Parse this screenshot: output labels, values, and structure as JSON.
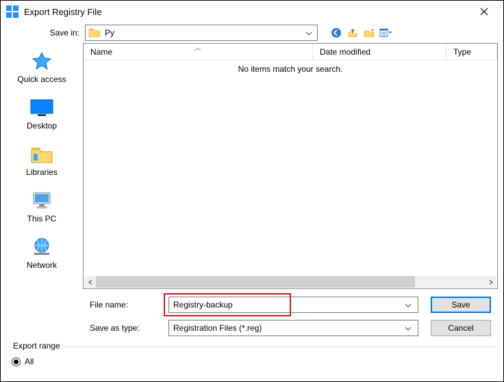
{
  "title": "Export Registry File",
  "save_in_label": "Save in:",
  "save_in_value": "Py",
  "columns": {
    "name": "Name",
    "date": "Date modified",
    "type": "Type"
  },
  "empty_message": "No items match your search.",
  "places": {
    "quick_access": "Quick access",
    "desktop": "Desktop",
    "libraries": "Libraries",
    "this_pc": "This PC",
    "network": "Network"
  },
  "file_name_label": "File name:",
  "file_name_value": "Registry-backup",
  "save_as_type_label": "Save as type:",
  "save_as_type_value": "Registration Files (*.reg)",
  "buttons": {
    "save": "Save",
    "cancel": "Cancel"
  },
  "export_range": {
    "legend": "Export range",
    "all": "All"
  },
  "icons": {
    "app": "registry-icon",
    "close": "close-icon",
    "folder": "folder-icon"
  }
}
